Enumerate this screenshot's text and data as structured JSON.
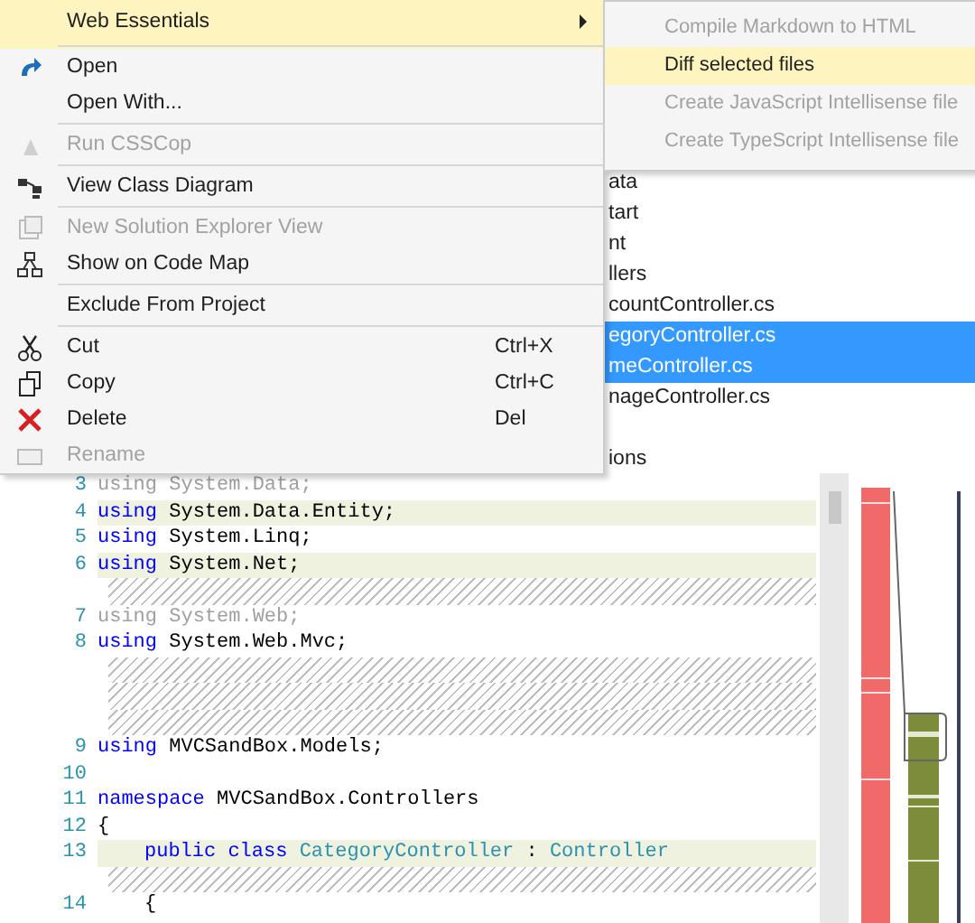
{
  "context_menu": {
    "items": [
      {
        "label": "Web Essentials",
        "selected": true,
        "disabled": false,
        "submenu": true,
        "separator_after": true
      },
      {
        "label": "Open",
        "selected": false,
        "disabled": false,
        "submenu": false,
        "separator_after": false
      },
      {
        "label": "Open With...",
        "selected": false,
        "disabled": false,
        "submenu": false,
        "separator_after": true
      },
      {
        "label": "Run CSSCop",
        "selected": false,
        "disabled": true,
        "submenu": false,
        "separator_after": true
      },
      {
        "label": "View Class Diagram",
        "selected": false,
        "disabled": false,
        "submenu": false,
        "separator_after": true
      },
      {
        "label": "New Solution Explorer View",
        "selected": false,
        "disabled": true,
        "submenu": false,
        "separator_after": false
      },
      {
        "label": "Show on Code Map",
        "selected": false,
        "disabled": false,
        "submenu": false,
        "separator_after": true
      },
      {
        "label": "Exclude From Project",
        "selected": false,
        "disabled": false,
        "submenu": false,
        "separator_after": true
      },
      {
        "label": "Cut",
        "shortcut": "Ctrl+X",
        "selected": false,
        "disabled": false,
        "submenu": false,
        "separator_after": false
      },
      {
        "label": "Copy",
        "shortcut": "Ctrl+C",
        "selected": false,
        "disabled": false,
        "submenu": false,
        "separator_after": false
      },
      {
        "label": "Delete",
        "shortcut": "Del",
        "selected": false,
        "disabled": false,
        "submenu": false,
        "separator_after": false
      },
      {
        "label": "Rename",
        "selected": false,
        "disabled": true,
        "submenu": false,
        "separator_after": false
      }
    ]
  },
  "submenu": {
    "items": [
      {
        "label": "Compile Markdown to HTML",
        "selected": false,
        "disabled": true
      },
      {
        "label": "Diff selected files",
        "selected": true,
        "disabled": false
      },
      {
        "label": "Create JavaScript Intellisense file",
        "selected": false,
        "disabled": true
      },
      {
        "label": "Create TypeScript Intellisense file",
        "selected": false,
        "disabled": true
      }
    ]
  },
  "solution_explorer": {
    "items": [
      {
        "label": "ata",
        "selected": false
      },
      {
        "label": "tart",
        "selected": false
      },
      {
        "label": "nt",
        "selected": false
      },
      {
        "label": "llers",
        "selected": false
      },
      {
        "label": "countController.cs",
        "selected": false
      },
      {
        "label": "egoryController.cs",
        "selected": true
      },
      {
        "label": "meController.cs",
        "selected": true
      },
      {
        "label": "nageController.cs",
        "selected": false
      },
      {
        "label": "ions",
        "selected": false,
        "gap_before": true
      }
    ]
  },
  "editor": {
    "lines": [
      {
        "kind": "code",
        "number": "3",
        "dimmed": true,
        "highlight": false,
        "segments": [
          {
            "kind": "keyword",
            "text": "using"
          },
          {
            "kind": "plain",
            "text": " System.Data;"
          }
        ]
      },
      {
        "kind": "code",
        "number": "4",
        "dimmed": false,
        "highlight": true,
        "segments": [
          {
            "kind": "keyword",
            "text": "using"
          },
          {
            "kind": "plain",
            "text": " System.Data.Entity;"
          }
        ]
      },
      {
        "kind": "code",
        "number": "5",
        "dimmed": false,
        "highlight": false,
        "segments": [
          {
            "kind": "keyword",
            "text": "using"
          },
          {
            "kind": "plain",
            "text": " System.Linq;"
          }
        ]
      },
      {
        "kind": "code",
        "number": "6",
        "dimmed": false,
        "highlight": true,
        "segments": [
          {
            "kind": "keyword",
            "text": "using"
          },
          {
            "kind": "plain",
            "text": " System.Net;"
          }
        ]
      },
      {
        "kind": "hatch"
      },
      {
        "kind": "code",
        "number": "7",
        "dimmed": true,
        "highlight": false,
        "segments": [
          {
            "kind": "keyword",
            "text": "using"
          },
          {
            "kind": "plain",
            "text": " System.Web;"
          }
        ]
      },
      {
        "kind": "code",
        "number": "8",
        "dimmed": false,
        "highlight": false,
        "segments": [
          {
            "kind": "keyword",
            "text": "using"
          },
          {
            "kind": "plain",
            "text": " System.Web.Mvc;"
          }
        ]
      },
      {
        "kind": "hatch"
      },
      {
        "kind": "hatch"
      },
      {
        "kind": "hatch"
      },
      {
        "kind": "code",
        "number": "9",
        "dimmed": false,
        "highlight": false,
        "segments": [
          {
            "kind": "keyword",
            "text": "using"
          },
          {
            "kind": "plain",
            "text": " MVCSandBox.Models;"
          }
        ]
      },
      {
        "kind": "code",
        "number": "10"
      },
      {
        "kind": "code",
        "number": "11",
        "dimmed": false,
        "highlight": false,
        "segments": [
          {
            "kind": "keyword",
            "text": "namespace"
          },
          {
            "kind": "plain",
            "text": " MVCSandBox.Controllers"
          }
        ]
      },
      {
        "kind": "code",
        "number": "12",
        "dimmed": false,
        "highlight": false,
        "segments": [
          {
            "kind": "plain",
            "text": "{"
          }
        ]
      },
      {
        "kind": "code",
        "number": "13",
        "dimmed": false,
        "highlight": true,
        "indent": true,
        "segments": [
          {
            "kind": "keyword",
            "text": "public"
          },
          {
            "kind": "keyword",
            "text": " class"
          },
          {
            "kind": "type",
            "text": " CategoryController"
          },
          {
            "kind": "plain",
            "text": " : "
          },
          {
            "kind": "type",
            "text": "Controller"
          }
        ]
      },
      {
        "kind": "hatch"
      },
      {
        "kind": "code",
        "number": "14",
        "dimmed": false,
        "highlight": false,
        "indent": true,
        "segments": [
          {
            "kind": "plain",
            "text": "{"
          }
        ]
      }
    ]
  }
}
